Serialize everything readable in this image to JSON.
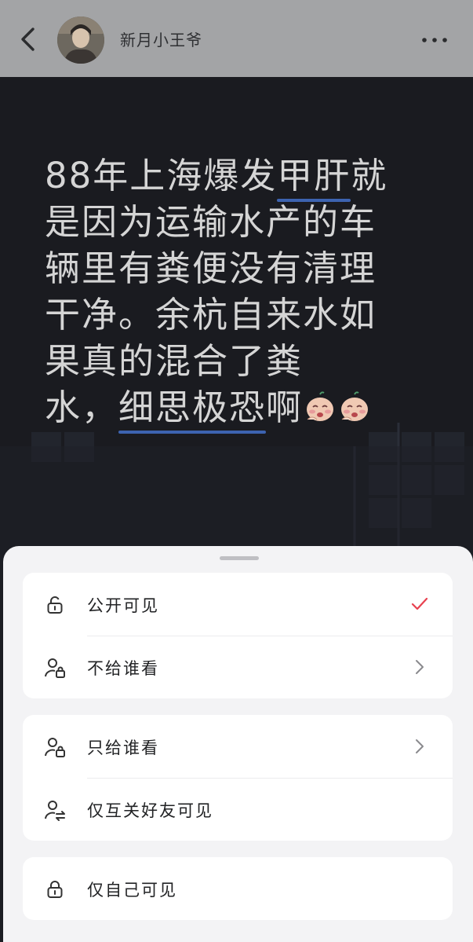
{
  "header": {
    "username": "新月小王爷",
    "back_icon": "chevron-left-icon",
    "more_icon": "more-horizontal-icon"
  },
  "post": {
    "lines": [
      {
        "before": "88年上海爆发",
        "underlined": "甲肝",
        "after": "就"
      },
      {
        "before": "是因为运输水产的车"
      },
      {
        "before": "辆里有粪便没有清理"
      },
      {
        "before": "干净。余杭自来水如"
      },
      {
        "before": "果真的混合了粪"
      },
      {
        "before": "水，",
        "underlined": "细思极恐",
        "after": "啊"
      }
    ],
    "emoji": "crying-emoji",
    "underline_color": "#3d63b0"
  },
  "visibility_sheet": {
    "groups": [
      {
        "options": [
          {
            "label": "公开可见",
            "icon": "lock-open-icon",
            "selected": true
          },
          {
            "label": "不给谁看",
            "icon": "user-lock-icon",
            "chevron": true
          }
        ]
      },
      {
        "options": [
          {
            "label": "只给谁看",
            "icon": "user-lock-icon",
            "chevron": true
          },
          {
            "label": "仅互关好友可见",
            "icon": "mutual-friends-icon"
          }
        ]
      },
      {
        "options": [
          {
            "label": "仅自己可见",
            "icon": "lock-icon"
          }
        ]
      }
    ],
    "check_color": "#e8414f"
  }
}
